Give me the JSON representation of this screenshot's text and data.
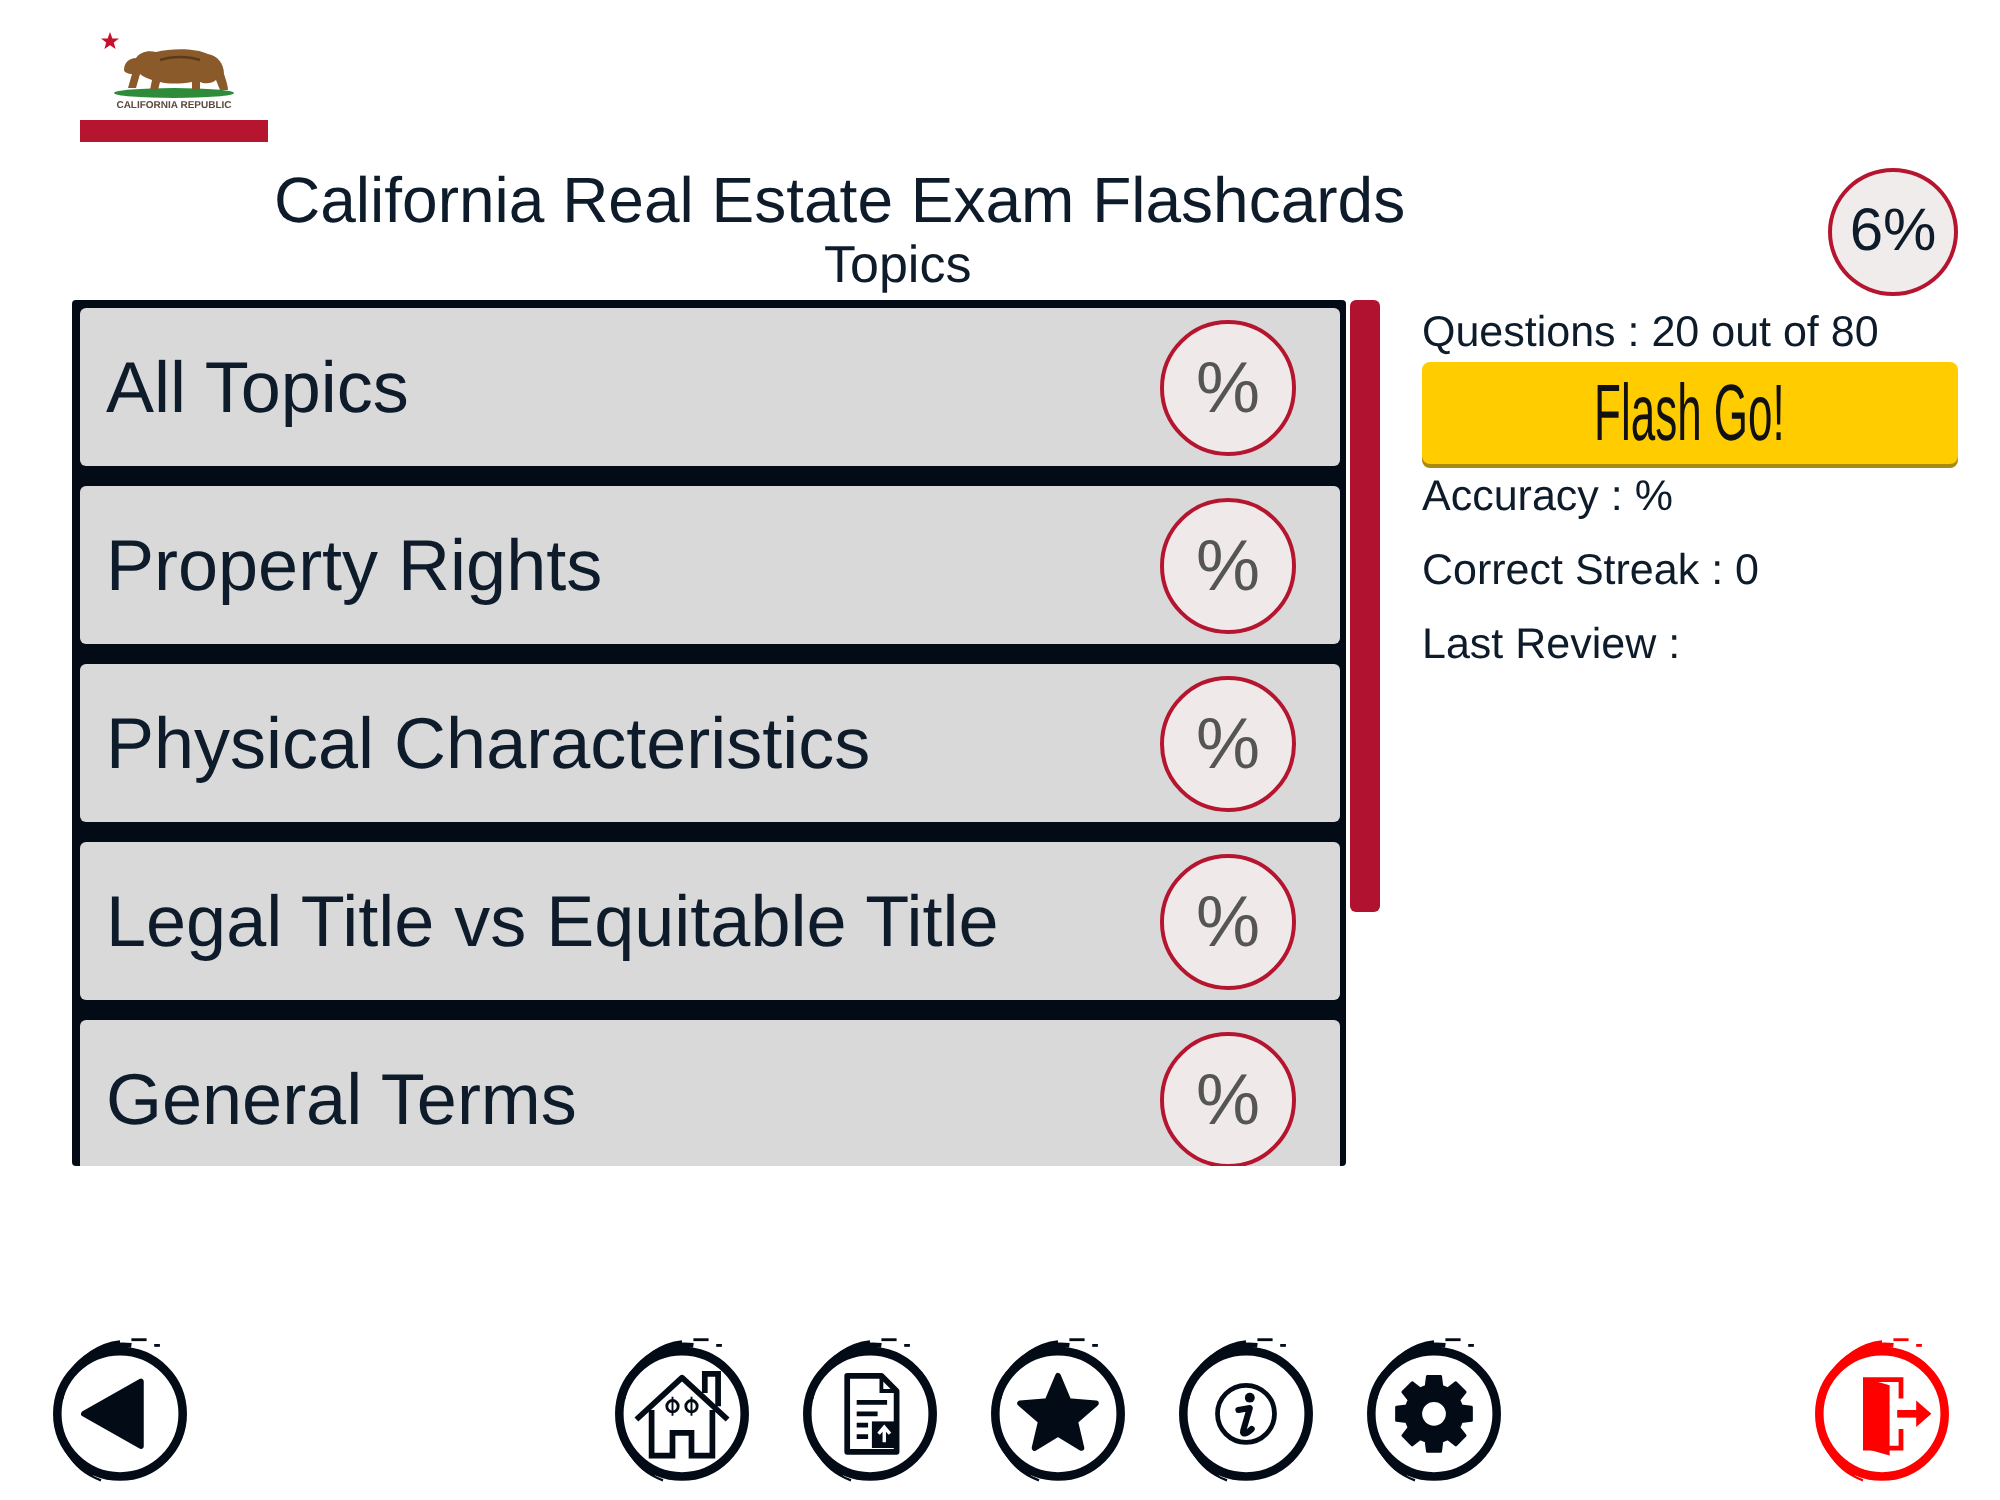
{
  "header": {
    "logo_caption": "CALIFORNIA REPUBLIC",
    "title": "California Real Estate Exam Flashcards",
    "subtitle": "Topics",
    "progress_badge": "6%"
  },
  "topics": [
    {
      "label": "All Topics",
      "score": "%"
    },
    {
      "label": "Property Rights",
      "score": "%"
    },
    {
      "label": "Physical Characteristics",
      "score": "%"
    },
    {
      "label": "Legal Title vs Equitable Title",
      "score": "%"
    },
    {
      "label": "General Terms",
      "score": "%"
    }
  ],
  "stats": {
    "questions": "Questions : 20 out of 80",
    "button": "Flash Go!",
    "accuracy": "Accuracy : %",
    "streak": "Correct Streak : 0",
    "last_review": "Last Review :"
  }
}
